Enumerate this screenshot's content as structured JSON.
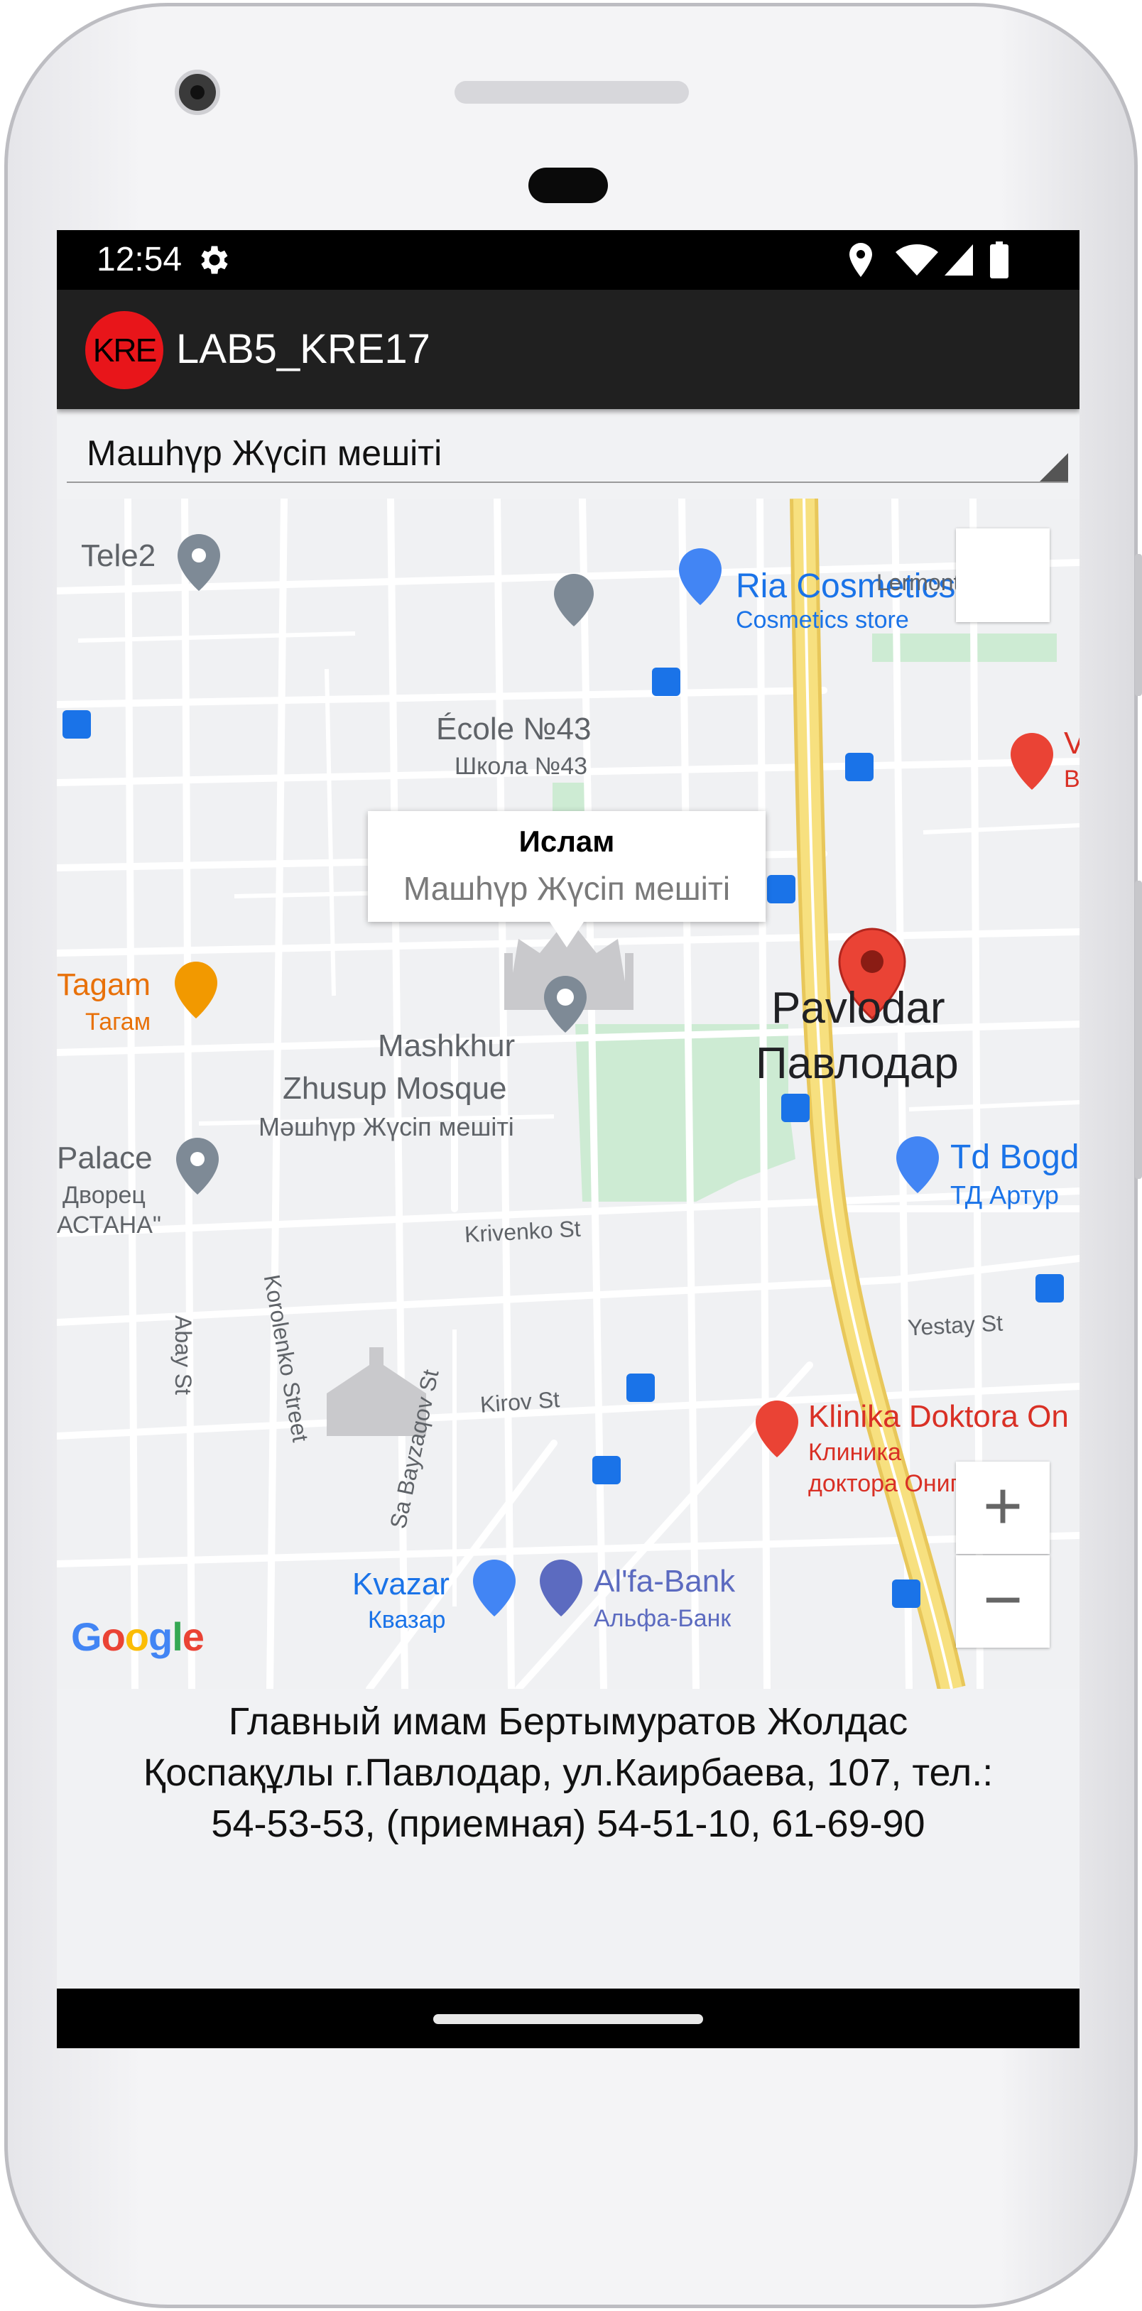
{
  "status_bar": {
    "time": "12:54",
    "icons": [
      "gear-icon",
      "location-icon",
      "wifi-icon",
      "signal-icon",
      "battery-icon"
    ]
  },
  "app_bar": {
    "logo_text": "KRE",
    "title": "LAB5_KRE17",
    "colors": {
      "bar": "#202020",
      "logo": "#e8151a"
    }
  },
  "spinner": {
    "selected": "Машһүр Жүсіп мешіті"
  },
  "map": {
    "info_window": {
      "title": "Ислам",
      "snippet": "Машһүр Жүсіп мешіті"
    },
    "marker": {
      "type": "red-pin",
      "color": "#ea4335"
    },
    "labels": {
      "tele2": "Tele2",
      "ria": "Ria Cosmetics",
      "ria_sub": "Cosmetics store",
      "lermontov": "Lermontov St",
      "ecole": "École №43",
      "ecole_sub": "Школа №43",
      "tagam": "Tagam",
      "tagam_sub": "Тагам",
      "mashkhur1": "Mashkhur",
      "mashkhur2": "Zhusup Mosque",
      "mashkhur_sub": "Мәшһүр Жүсіп мешіті",
      "pavlodar": "Pavlodar",
      "pavlodar_ru": "Павлодар",
      "palace": "Palace",
      "palace_sub1": "Дворец",
      "palace_sub2": "АСТАНА\"",
      "tdbogd": "Td Bogd",
      "tdbogd_sub": "ТД Артур",
      "v_letter": "V",
      "v_sub": "В",
      "krivenko": "Krivenko St",
      "abay": "Abay St",
      "korolenko": "Korolenko Street",
      "yestay": "Yestay St",
      "kirov": "Kirov St",
      "bayzaqov": "Sa Bayzaqov St",
      "klinika": "Klinika Doktora On",
      "klinika_sub1": "Клиника",
      "klinika_sub2": "доктора Онипко",
      "kvazar": "Kvazar",
      "kvazar_sub": "Квазар",
      "alfa": "Al'fa-Bank",
      "alfa_sub": "Альфа-Банк"
    },
    "controls": {
      "zoom_in": "+",
      "zoom_out": "−"
    },
    "attribution": "Google"
  },
  "description": {
    "line1": "Главный имам Бертымуратов Жолдас",
    "line2": "Қоспақұлы г.Павлодар, ул.Каирбаева, 107, тел.:",
    "line3": "54-53-53, (приемная) 54-51-10, 61-69-90"
  }
}
